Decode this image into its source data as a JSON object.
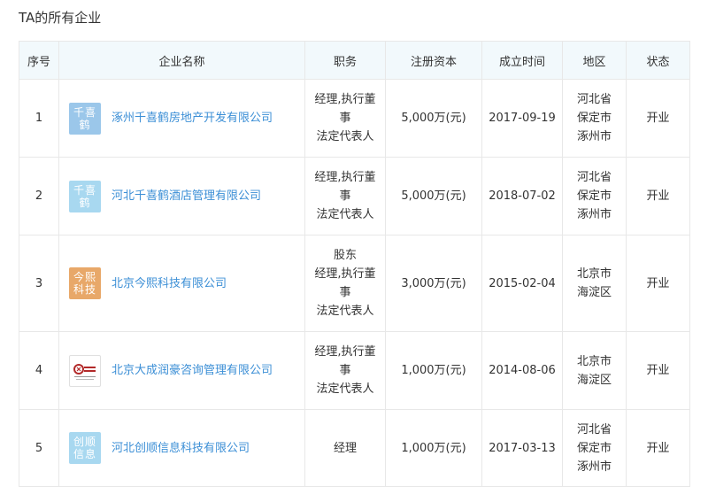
{
  "section_title": "TA的所有企业",
  "columns": [
    "序号",
    "企业名称",
    "职务",
    "注册资本",
    "成立时间",
    "地区",
    "状态"
  ],
  "rows": [
    {
      "index": "1",
      "logo_text": "千喜鹤",
      "logo_color": "#9bc7ea",
      "company_name": "涿州千喜鹤房地产开发有限公司",
      "position_lines": [
        "经理,执行董",
        "事",
        "法定代表人"
      ],
      "capital": "5,000万(元)",
      "established": "2017-09-19",
      "region_lines": [
        "河北省",
        "保定市",
        "涿州市"
      ],
      "status": "开业"
    },
    {
      "index": "2",
      "logo_text": "千喜鹤",
      "logo_color": "#a8d8f0",
      "company_name": "河北千喜鹤酒店管理有限公司",
      "position_lines": [
        "经理,执行董",
        "事",
        "法定代表人"
      ],
      "capital": "5,000万(元)",
      "established": "2018-07-02",
      "region_lines": [
        "河北省",
        "保定市",
        "涿州市"
      ],
      "status": "开业"
    },
    {
      "index": "3",
      "logo_text": "今熙科技",
      "logo_color": "#e8a869",
      "company_name": "北京今熙科技有限公司",
      "position_lines": [
        "股东",
        "经理,执行董",
        "事",
        "法定代表人"
      ],
      "capital": "3,000万(元)",
      "established": "2015-02-04",
      "region_lines": [
        "北京市",
        "海淀区"
      ],
      "status": "开业"
    },
    {
      "index": "4",
      "logo_text": "",
      "logo_color": "#ffffff",
      "company_name": "北京大成润豪咨询管理有限公司",
      "position_lines": [
        "经理,执行董",
        "事",
        "法定代表人"
      ],
      "capital": "1,000万(元)",
      "established": "2014-08-06",
      "region_lines": [
        "北京市",
        "海淀区"
      ],
      "status": "开业"
    },
    {
      "index": "5",
      "logo_text": "创顺信息",
      "logo_color": "#a8d8f0",
      "company_name": "河北创顺信息科技有限公司",
      "position_lines": [
        "经理"
      ],
      "capital": "1,000万(元)",
      "established": "2017-03-13",
      "region_lines": [
        "河北省",
        "保定市",
        "涿州市"
      ],
      "status": "开业"
    }
  ]
}
